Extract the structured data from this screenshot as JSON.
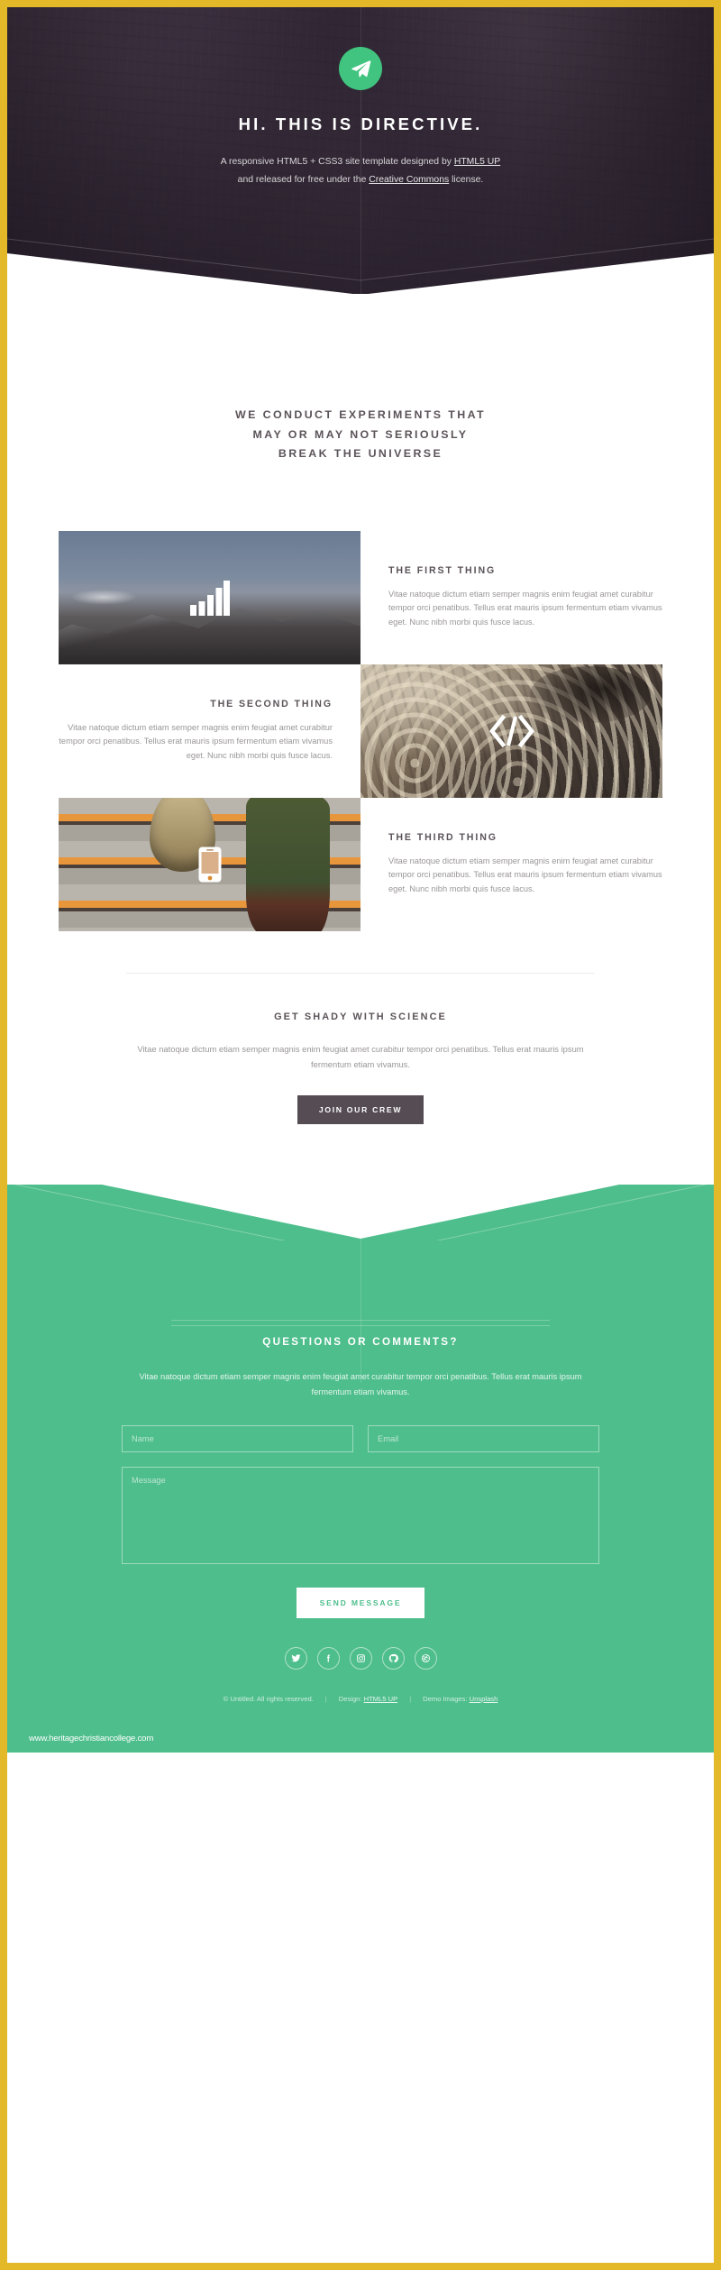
{
  "colors": {
    "frame_border": "#E3B829",
    "banner_bg": "#2f2633",
    "accent_green": "#4EBE8C",
    "logo_green": "#40c47f",
    "dark_button": "#554c54",
    "heading_text": "#5b5359",
    "body_text": "#9a9699"
  },
  "banner": {
    "logo_icon": "paper-plane-icon",
    "title": "HI. THIS IS DIRECTIVE.",
    "subtitle_line1_pre": "A responsive HTML5 + CSS3 site template designed by ",
    "subtitle_line1_link": "HTML5 UP",
    "subtitle_line2_pre": "and released for free under the ",
    "subtitle_line2_link": "Creative Commons",
    "subtitle_line2_post": " license."
  },
  "main": {
    "headline_line1": "WE CONDUCT EXPERIMENTS THAT",
    "headline_line2": "MAY OR MAY NOT SERIOUSLY",
    "headline_line3": "BREAK THE UNIVERSE",
    "things": [
      {
        "title": "THE FIRST THING",
        "body": "Vitae natoque dictum etiam semper magnis enim feugiat amet curabitur tempor orci penatibus. Tellus erat mauris ipsum fermentum etiam vivamus eget. Nunc nibh morbi quis fusce lacus.",
        "image": "snowy-mountain-photo",
        "icon": "bar-chart-icon"
      },
      {
        "title": "THE SECOND THING",
        "body": "Vitae natoque dictum etiam semper magnis enim feugiat amet curabitur tempor orci penatibus. Tellus erat mauris ipsum fermentum etiam vivamus eget. Nunc nibh morbi quis fusce lacus.",
        "image": "vintage-typewriter-photo",
        "icon": "code-brackets-icon"
      },
      {
        "title": "THE THIRD THING",
        "body": "Vitae natoque dictum etiam semper magnis enim feugiat amet curabitur tempor orci penatibus. Tellus erat mauris ipsum fermentum etiam vivamus eget. Nunc nibh morbi quis fusce lacus.",
        "image": "stairs-walking-photo",
        "icon": "mobile-phone-icon"
      }
    ],
    "cta": {
      "title": "GET SHADY WITH SCIENCE",
      "body": "Vitae natoque dictum etiam semper magnis enim feugiat amet curabitur tempor orci penatibus. Tellus erat mauris ipsum fermentum etiam vivamus.",
      "button_label": "JOIN OUR CREW"
    }
  },
  "contact": {
    "title": "QUESTIONS OR COMMENTS?",
    "body": "Vitae natoque dictum etiam semper magnis enim feugiat amet curabitur tempor orci penatibus. Tellus erat mauris ipsum fermentum etiam vivamus.",
    "name_placeholder": "Name",
    "name_value": "",
    "email_placeholder": "Email",
    "email_value": "",
    "message_placeholder": "Message",
    "message_value": "",
    "submit_label": "SEND MESSAGE",
    "socials": [
      {
        "name": "twitter-icon"
      },
      {
        "name": "facebook-icon"
      },
      {
        "name": "instagram-icon"
      },
      {
        "name": "github-icon"
      },
      {
        "name": "dribbble-icon"
      }
    ]
  },
  "footer": {
    "copyright": "© Untitled. All rights reserved.",
    "design_label": "Design: ",
    "design_link": "HTML5 UP",
    "images_label": "Demo Images: ",
    "images_link": "Unsplash",
    "separator": "|",
    "watermark": "www.heritagechristiancollege.com"
  }
}
